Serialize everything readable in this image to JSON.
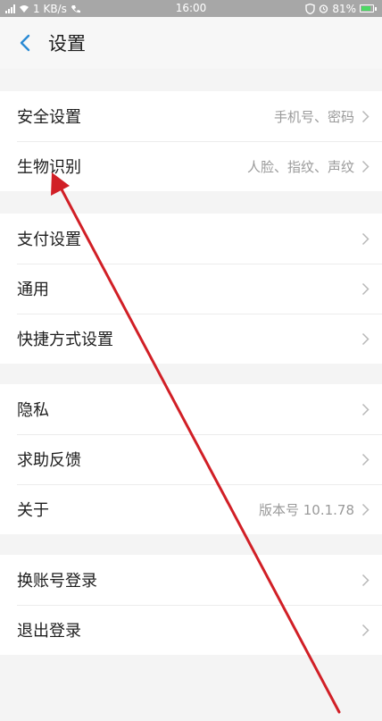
{
  "status_bar": {
    "network_speed": "1 KB/s",
    "time": "16:00",
    "battery_percent": "81%",
    "battery_level": 0.81
  },
  "header": {
    "title": "设置"
  },
  "groups": [
    {
      "items": [
        {
          "label": "安全设置",
          "value": "手机号、密码"
        },
        {
          "label": "生物识别",
          "value": "人脸、指纹、声纹"
        }
      ]
    },
    {
      "items": [
        {
          "label": "支付设置"
        },
        {
          "label": "通用"
        },
        {
          "label": "快捷方式设置"
        }
      ]
    },
    {
      "items": [
        {
          "label": "隐私"
        },
        {
          "label": "求助反馈"
        },
        {
          "label": "关于",
          "value": "版本号 10.1.78"
        }
      ]
    },
    {
      "items": [
        {
          "label": "换账号登录"
        },
        {
          "label": "退出登录"
        }
      ]
    }
  ],
  "colors": {
    "accent": "#2a8ad4",
    "annotation_arrow": "#d11f26",
    "background": "#f4f4f4"
  }
}
